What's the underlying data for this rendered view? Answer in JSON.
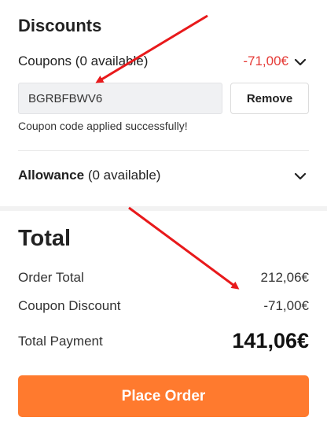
{
  "discounts": {
    "title": "Discounts",
    "coupons": {
      "label": "Coupons",
      "availability": "(0 available)",
      "amount": "-71,00€",
      "input_value": "BGRBFBWV6",
      "remove_label": "Remove",
      "success_message": "Coupon code applied successfully!"
    },
    "allowance": {
      "label": "Allowance",
      "availability": "(0 available)"
    }
  },
  "total": {
    "title": "Total",
    "order_total_label": "Order Total",
    "order_total_value": "212,06€",
    "coupon_discount_label": "Coupon Discount",
    "coupon_discount_value": "-71,00€",
    "payment_label": "Total Payment",
    "payment_value": "141,06€"
  },
  "place_order_label": "Place Order",
  "colors": {
    "accent_orange": "#ff7a2e",
    "discount_red": "#e53935",
    "annotation_arrow": "#e8191b"
  },
  "icons": [
    "chevron-down-icon",
    "annotation-arrow"
  ]
}
